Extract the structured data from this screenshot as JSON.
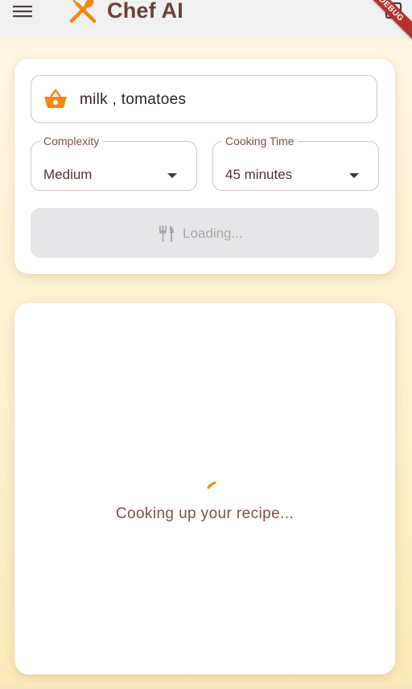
{
  "appbar": {
    "title": "Chef AI",
    "debug_banner": "DEBUG",
    "icons": {
      "menu": "menu-icon",
      "logo": "fork-spoon-icon",
      "action": "bookmark-icon"
    },
    "colors": {
      "background": "#f1f0f1",
      "title": "#6b4038",
      "logo": "#f5880e"
    }
  },
  "form": {
    "ingredients": {
      "value": "milk , tomatoes",
      "icon": "basket-icon"
    },
    "complexity": {
      "label": "Complexity",
      "value": "Medium"
    },
    "cooking_time": {
      "label": "Cooking Time",
      "value": "45 minutes"
    },
    "generate_button": {
      "label": "Loading...",
      "icon": "restaurant-icon",
      "state": "disabled"
    }
  },
  "result": {
    "loading_text": "Cooking up your recipe...",
    "spinner_color": "#f5880e"
  },
  "colors": {
    "accent": "#f5880e",
    "text_brown": "#7a5148",
    "debug_red": "#b5312b"
  }
}
